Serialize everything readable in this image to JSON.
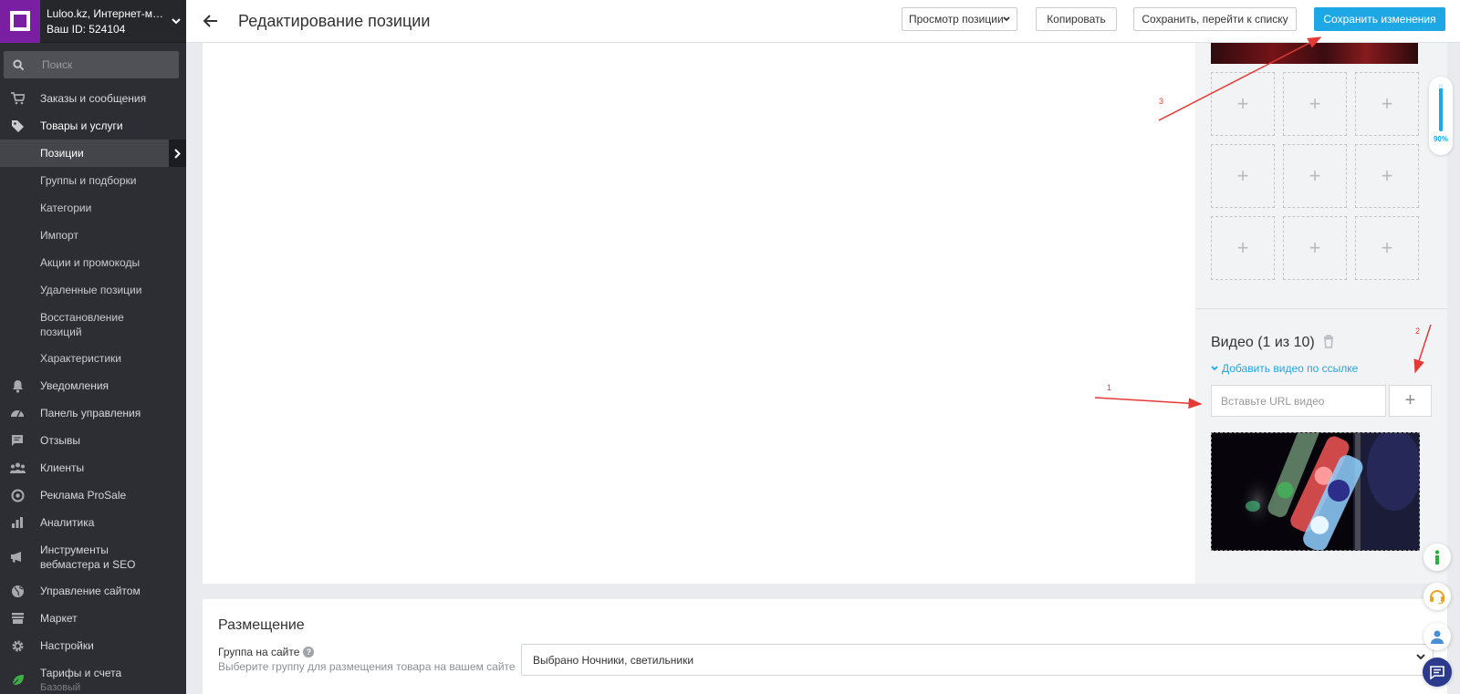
{
  "account": {
    "name": "Luloo.kz, Интернет-магазин",
    "id_text": "Ваш ID: 524104"
  },
  "search": {
    "placeholder": "Поиск"
  },
  "sidebar": {
    "items": [
      {
        "label": "Заказы и сообщения",
        "icon": "cart-icon"
      },
      {
        "label": "Товары и услуги",
        "icon": "tag-icon"
      },
      {
        "label": "Позиции"
      },
      {
        "label": "Группы и подборки"
      },
      {
        "label": "Категории"
      },
      {
        "label": "Импорт"
      },
      {
        "label": "Акции и промокоды"
      },
      {
        "label": "Удаленные позиции"
      },
      {
        "label": "Восстановление позиций"
      },
      {
        "label": "Характеристики"
      },
      {
        "label": "Уведомления",
        "icon": "bell-icon"
      },
      {
        "label": "Панель управления",
        "icon": "dashboard-icon"
      },
      {
        "label": "Отзывы",
        "icon": "review-icon"
      },
      {
        "label": "Клиенты",
        "icon": "clients-icon"
      },
      {
        "label": "Реклама ProSale",
        "icon": "target-icon"
      },
      {
        "label": "Аналитика",
        "icon": "analytics-icon"
      },
      {
        "label": "Инструменты вебмастера и SEO",
        "icon": "megaphone-icon"
      },
      {
        "label": "Управление сайтом",
        "icon": "globe-icon"
      },
      {
        "label": "Маркет",
        "icon": "store-icon"
      },
      {
        "label": "Настройки",
        "icon": "gear-icon"
      },
      {
        "label": "Тарифы и счета",
        "note": "Базовый",
        "icon": "leaf-icon"
      }
    ]
  },
  "header": {
    "title": "Редактирование позиции",
    "view_label": "Просмотр позиции",
    "copy_label": "Копировать",
    "save_list_label": "Сохранить, перейти к списку",
    "save_label": "Сохранить изменения"
  },
  "photos": {
    "slot_symbol": "+"
  },
  "video": {
    "title": "Видео (1 из 10)",
    "add_link": "Добавить видео по ссылке",
    "url_placeholder": "Вставьте URL видео",
    "add_symbol": "+"
  },
  "progress": {
    "value": 0.9,
    "label": "90%"
  },
  "placement": {
    "title": "Размещение",
    "group_label": "Группа на сайте",
    "group_hint": "Выберите группу для размещения товара на вашем сайте",
    "group_value": "Выбрано Ночники, светильники",
    "help_symbol": "?"
  },
  "annotations": {
    "label1": "1",
    "label2": "2",
    "label3": "3"
  },
  "colors": {
    "accent": "#1ea7e5",
    "sidebar": "#2d2e33",
    "logo": "#7b1fa2",
    "annotation": "#e53935"
  }
}
